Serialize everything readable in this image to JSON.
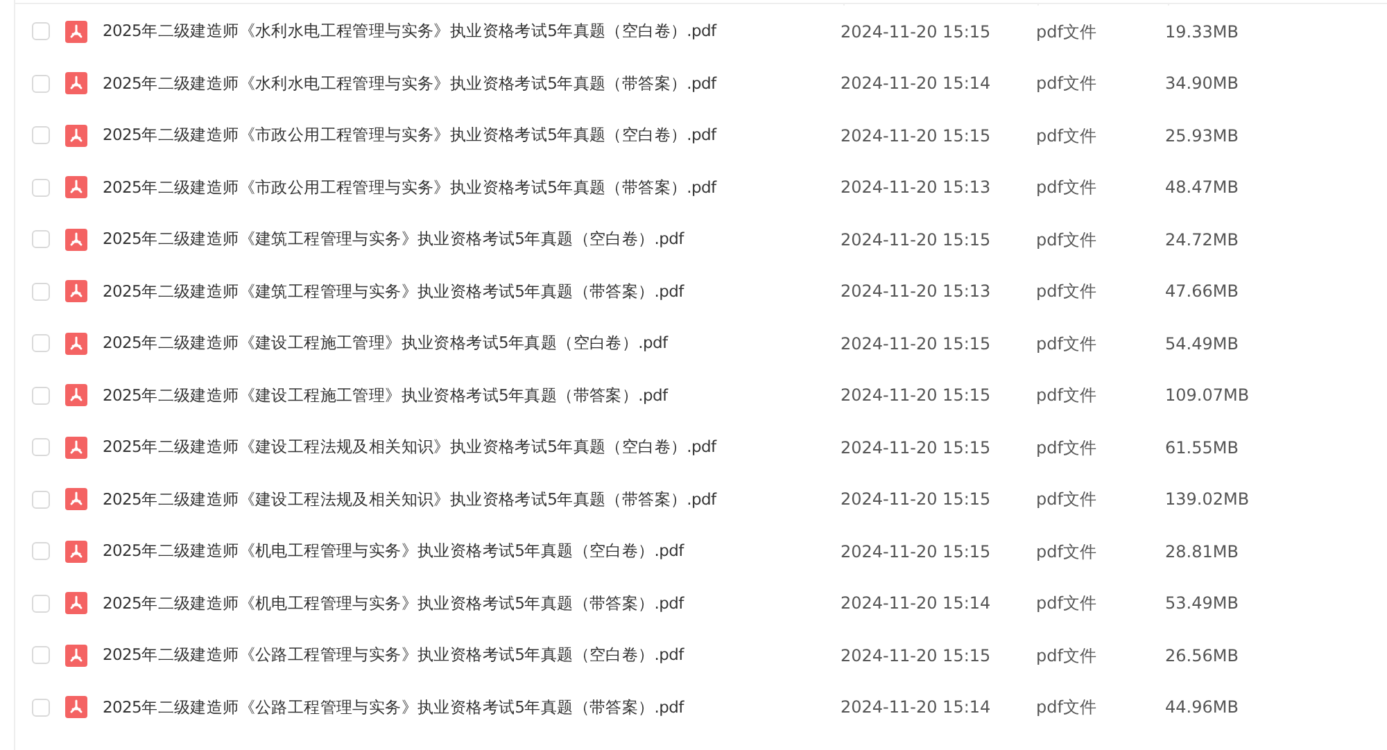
{
  "files": [
    {
      "name": "2025年二级建造师《水利水电工程管理与实务》执业资格考试5年真题（空白卷）.pdf",
      "modified": "2024-11-20 15:15",
      "type": "pdf文件",
      "size": "19.33MB",
      "checked": false
    },
    {
      "name": "2025年二级建造师《水利水电工程管理与实务》执业资格考试5年真题（带答案）.pdf",
      "modified": "2024-11-20 15:14",
      "type": "pdf文件",
      "size": "34.90MB",
      "checked": false
    },
    {
      "name": "2025年二级建造师《市政公用工程管理与实务》执业资格考试5年真题（空白卷）.pdf",
      "modified": "2024-11-20 15:15",
      "type": "pdf文件",
      "size": "25.93MB",
      "checked": false
    },
    {
      "name": "2025年二级建造师《市政公用工程管理与实务》执业资格考试5年真题（带答案）.pdf",
      "modified": "2024-11-20 15:13",
      "type": "pdf文件",
      "size": "48.47MB",
      "checked": false
    },
    {
      "name": "2025年二级建造师《建筑工程管理与实务》执业资格考试5年真题（空白卷）.pdf",
      "modified": "2024-11-20 15:15",
      "type": "pdf文件",
      "size": "24.72MB",
      "checked": false
    },
    {
      "name": "2025年二级建造师《建筑工程管理与实务》执业资格考试5年真题（带答案）.pdf",
      "modified": "2024-11-20 15:13",
      "type": "pdf文件",
      "size": "47.66MB",
      "checked": false
    },
    {
      "name": "2025年二级建造师《建设工程施工管理》执业资格考试5年真题（空白卷）.pdf",
      "modified": "2024-11-20 15:15",
      "type": "pdf文件",
      "size": "54.49MB",
      "checked": false
    },
    {
      "name": "2025年二级建造师《建设工程施工管理》执业资格考试5年真题（带答案）.pdf",
      "modified": "2024-11-20 15:15",
      "type": "pdf文件",
      "size": "109.07MB",
      "checked": false
    },
    {
      "name": "2025年二级建造师《建设工程法规及相关知识》执业资格考试5年真题（空白卷）.pdf",
      "modified": "2024-11-20 15:15",
      "type": "pdf文件",
      "size": "61.55MB",
      "checked": false
    },
    {
      "name": "2025年二级建造师《建设工程法规及相关知识》执业资格考试5年真题（带答案）.pdf",
      "modified": "2024-11-20 15:15",
      "type": "pdf文件",
      "size": "139.02MB",
      "checked": false
    },
    {
      "name": "2025年二级建造师《机电工程管理与实务》执业资格考试5年真题（空白卷）.pdf",
      "modified": "2024-11-20 15:15",
      "type": "pdf文件",
      "size": "28.81MB",
      "checked": false
    },
    {
      "name": "2025年二级建造师《机电工程管理与实务》执业资格考试5年真题（带答案）.pdf",
      "modified": "2024-11-20 15:14",
      "type": "pdf文件",
      "size": "53.49MB",
      "checked": false
    },
    {
      "name": "2025年二级建造师《公路工程管理与实务》执业资格考试5年真题（空白卷）.pdf",
      "modified": "2024-11-20 15:15",
      "type": "pdf文件",
      "size": "26.56MB",
      "checked": false
    },
    {
      "name": "2025年二级建造师《公路工程管理与实务》执业资格考试5年真题（带答案）.pdf",
      "modified": "2024-11-20 15:14",
      "type": "pdf文件",
      "size": "44.96MB",
      "checked": false
    }
  ]
}
